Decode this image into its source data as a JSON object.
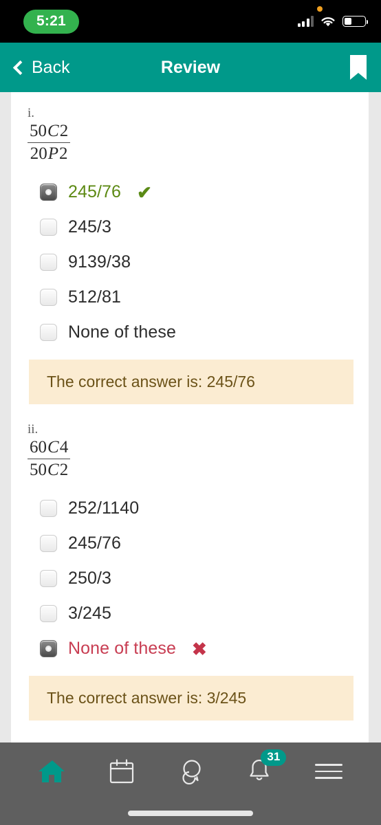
{
  "statusbar": {
    "time": "5:21",
    "cellular_icon": "cellular-signal-icon",
    "wifi_icon": "wifi-icon",
    "battery_icon": "battery-icon",
    "privacy_indicator": "orange-privacy-dot"
  },
  "navbar": {
    "back_label": "Back",
    "title": "Review",
    "back_icon": "chevron-left-icon",
    "bookmark_icon": "bookmark-icon",
    "accent_color": "#00998a"
  },
  "questions": [
    {
      "number": "i.",
      "formula": {
        "numerator_prefix": "50",
        "numerator_op": "C",
        "numerator_suffix": "2",
        "denominator_prefix": "20",
        "denominator_op": "P",
        "denominator_suffix": "2"
      },
      "options": [
        {
          "label": "245/76",
          "selected": true,
          "state": "correct",
          "mark": "✔"
        },
        {
          "label": "245/3",
          "selected": false,
          "state": "none",
          "mark": ""
        },
        {
          "label": "9139/38",
          "selected": false,
          "state": "none",
          "mark": ""
        },
        {
          "label": "512/81",
          "selected": false,
          "state": "none",
          "mark": ""
        },
        {
          "label": "None of these",
          "selected": false,
          "state": "none",
          "mark": ""
        }
      ],
      "answer_banner": "The correct answer is: 245/76"
    },
    {
      "number": "ii.",
      "formula": {
        "numerator_prefix": "60",
        "numerator_op": "C",
        "numerator_suffix": "4",
        "denominator_prefix": "50",
        "denominator_op": "C",
        "denominator_suffix": "2"
      },
      "options": [
        {
          "label": "252/1140",
          "selected": false,
          "state": "none",
          "mark": ""
        },
        {
          "label": "245/76",
          "selected": false,
          "state": "none",
          "mark": ""
        },
        {
          "label": "250/3",
          "selected": false,
          "state": "none",
          "mark": ""
        },
        {
          "label": "3/245",
          "selected": false,
          "state": "none",
          "mark": ""
        },
        {
          "label": "None of these",
          "selected": true,
          "state": "wrong",
          "mark": "✖"
        }
      ],
      "answer_banner": "The correct answer is: 3/245"
    }
  ],
  "tabbar": {
    "items": [
      {
        "icon": "home-icon",
        "active": true,
        "badge": ""
      },
      {
        "icon": "calendar-icon",
        "active": false,
        "badge": ""
      },
      {
        "icon": "chat-icon",
        "active": false,
        "badge": ""
      },
      {
        "icon": "bell-icon",
        "active": false,
        "badge": "31"
      },
      {
        "icon": "hamburger-menu-icon",
        "active": false,
        "badge": ""
      }
    ],
    "active_color": "#00998a"
  }
}
